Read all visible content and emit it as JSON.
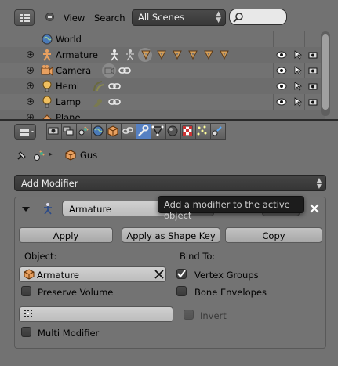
{
  "outliner": {
    "header": {
      "view_label": "View",
      "search_label": "Search",
      "scene_select": "All Scenes",
      "search_placeholder": ""
    },
    "rows": [
      {
        "label": "World",
        "icon": "world-icon"
      },
      {
        "label": "Armature",
        "icon": "armature-icon"
      },
      {
        "label": "Camera",
        "icon": "camera-icon"
      },
      {
        "label": "Hemi",
        "icon": "lamp-icon"
      },
      {
        "label": "Lamp",
        "icon": "lamp-icon"
      },
      {
        "label": "Plane",
        "icon": "mesh-icon"
      }
    ]
  },
  "properties": {
    "breadcrumb": {
      "object_name": "Gus"
    },
    "add_modifier_label": "Add Modifier",
    "tooltip": "Add a modifier to the active object",
    "modifier": {
      "name": "Armature",
      "apply_label": "Apply",
      "apply_shape_label": "Apply as Shape Key",
      "copy_label": "Copy",
      "object_heading": "Object:",
      "object_value": "Armature",
      "bind_to_heading": "Bind To:",
      "preserve_volume_label": "Preserve Volume",
      "preserve_volume": false,
      "vertex_groups_label": "Vertex Groups",
      "vertex_groups": true,
      "bone_envelopes_label": "Bone Envelopes",
      "bone_envelopes": false,
      "invert_label": "Invert",
      "invert": false,
      "multi_modifier_label": "Multi Modifier",
      "multi_modifier": false,
      "vertex_group_value": ""
    }
  },
  "colors": {
    "active_tab": "#5680c2",
    "panel_bg": "#727272",
    "tooltip_bg": "#1c1c1c"
  }
}
